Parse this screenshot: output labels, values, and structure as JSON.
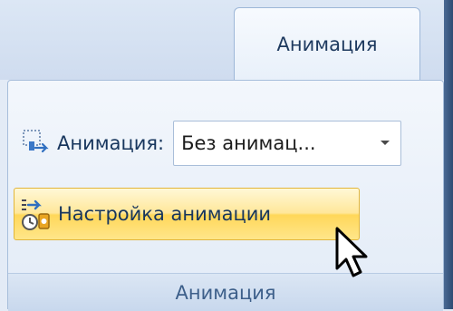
{
  "ribbon": {
    "active_tab": "Анимация",
    "group_label": "Анимация"
  },
  "animation": {
    "label": "Анимация:",
    "selected_value": "Без анимац...",
    "icon": "animation-icon"
  },
  "setup_button": {
    "label": "Настройка анимации",
    "icon": "custom-animation-icon"
  },
  "colors": {
    "ribbon_bg": "#dce7f5",
    "highlight_button": "#ffd75a",
    "text": "#17365d"
  }
}
